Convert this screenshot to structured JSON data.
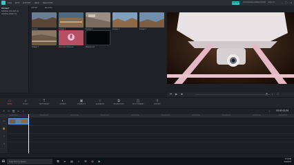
{
  "titlebar": {
    "menus": [
      "FILE",
      "EDIT",
      "EXPORT",
      "HELP",
      "REGISTER"
    ],
    "title": "",
    "export_label": "EXPORT",
    "links": [
      "WONDERSHARE",
      "REGISTER",
      "SIGN IN"
    ]
  },
  "library": {
    "sidebar_items": [
      "PROJECT",
      "SAMPLE COLORS (1)",
      "SAMPLE VIDEO (5)"
    ],
    "toolbar": [
      "IMPORT",
      "RECORD"
    ],
    "media": [
      {
        "label": "4k stock"
      },
      {
        "label": "footage 1"
      },
      {
        "label": "footage 2"
      },
      {
        "label": "footage 3"
      },
      {
        "label": "footage 4"
      },
      {
        "label": "footage 5"
      },
      {
        "label": "Recorded Voiceover"
      },
      {
        "label": "Background"
      }
    ]
  },
  "tools": [
    {
      "label": "MEDIA",
      "icon": "folder-icon"
    },
    {
      "label": "MUSIC",
      "icon": "music-icon"
    },
    {
      "label": "TEXT/CREDIT",
      "icon": "text-icon"
    },
    {
      "label": "FILTERS",
      "icon": "filter-icon"
    },
    {
      "label": "OVERLAYS",
      "icon": "overlay-icon"
    },
    {
      "label": "ELEMENTS",
      "icon": "elements-icon"
    },
    {
      "label": "TRANSITIONS",
      "icon": "transition-icon"
    },
    {
      "label": "SPLIT SCREEN",
      "icon": "split-screen-icon"
    },
    {
      "label": "EXPORT",
      "icon": "export-icon"
    }
  ],
  "timeline": {
    "timecode": "00:00:13:34",
    "ticks": [
      "00:00:00:00",
      "00:00:05:00",
      "00:00:10:00",
      "00:00:15:00",
      "00:00:20:00",
      "00:00:25:00",
      "00:00:30:00",
      "00:00:35:00",
      "00:00:40:00",
      "00:00:45:00"
    ]
  },
  "taskbar": {
    "search_placeholder": "Type here to search",
    "time": "1:57 PM",
    "date": "9/11/2017"
  },
  "colors": {
    "accent": "#3ec6c9",
    "active_tool": "#e24e5a",
    "clip": "#3a7bd5"
  }
}
